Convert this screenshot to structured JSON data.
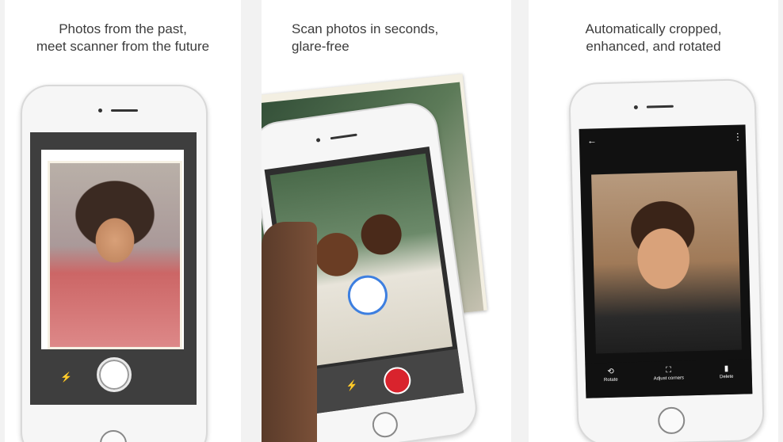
{
  "panels": [
    {
      "caption": [
        "Photos from the past,",
        "meet scanner from the future"
      ]
    },
    {
      "caption": [
        "Scan photos in seconds,",
        "glare-free"
      ]
    },
    {
      "caption": [
        "Automatically cropped,",
        "enhanced, and rotated"
      ],
      "tools": {
        "rotate": "Rotate",
        "adjust_corners": "Adjust corners",
        "delete": "Delete"
      }
    }
  ],
  "icons": {
    "flash": "flash-off-icon",
    "back": "back-arrow-icon",
    "more": "more-vert-icon",
    "rotate": "rotate-icon",
    "corners": "crop-corners-icon",
    "delete": "trash-icon"
  },
  "colors": {
    "record_button": "#d9232d",
    "focus_ring": "#3d7fe0",
    "text": "#3c3c3c"
  }
}
